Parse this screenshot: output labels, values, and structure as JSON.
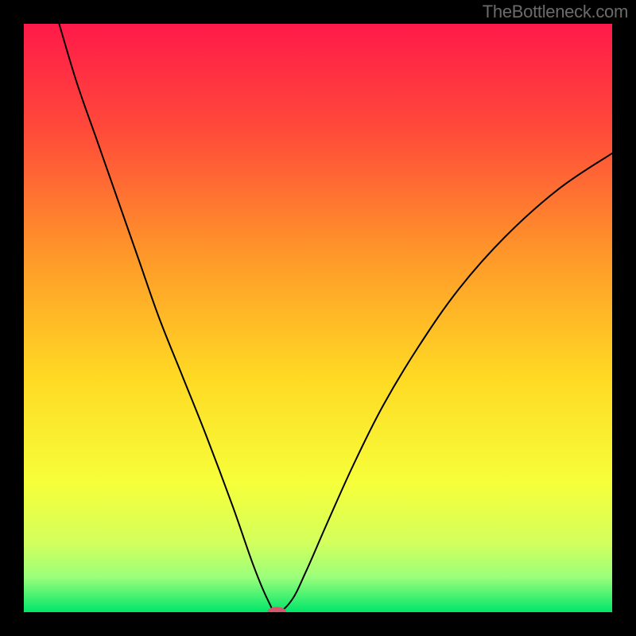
{
  "watermark": "TheBottleneck.com",
  "chart_data": {
    "type": "line",
    "title": "",
    "xlabel": "",
    "ylabel": "",
    "xlim": [
      0,
      100
    ],
    "ylim": [
      0,
      100
    ],
    "grid": false,
    "background_gradient": {
      "stops": [
        {
          "offset": 0.0,
          "color": "#ff1a49"
        },
        {
          "offset": 0.18,
          "color": "#ff4a3a"
        },
        {
          "offset": 0.4,
          "color": "#ff9a29"
        },
        {
          "offset": 0.6,
          "color": "#ffd924"
        },
        {
          "offset": 0.78,
          "color": "#f6ff3a"
        },
        {
          "offset": 0.88,
          "color": "#d4ff5c"
        },
        {
          "offset": 0.94,
          "color": "#9cff7a"
        },
        {
          "offset": 1.0,
          "color": "#00e66a"
        }
      ]
    },
    "curve": {
      "color": "#000000",
      "width": 2,
      "points": [
        {
          "x": 6.0,
          "y": 100.0
        },
        {
          "x": 9.0,
          "y": 90.0
        },
        {
          "x": 12.5,
          "y": 80.0
        },
        {
          "x": 16.0,
          "y": 70.0
        },
        {
          "x": 19.5,
          "y": 60.0
        },
        {
          "x": 23.0,
          "y": 50.0
        },
        {
          "x": 27.0,
          "y": 40.0
        },
        {
          "x": 31.0,
          "y": 30.0
        },
        {
          "x": 35.5,
          "y": 18.0
        },
        {
          "x": 39.0,
          "y": 8.0
        },
        {
          "x": 41.5,
          "y": 2.0
        },
        {
          "x": 43.0,
          "y": 0.0
        },
        {
          "x": 45.5,
          "y": 2.0
        },
        {
          "x": 48.0,
          "y": 7.0
        },
        {
          "x": 51.5,
          "y": 15.0
        },
        {
          "x": 56.0,
          "y": 25.0
        },
        {
          "x": 61.0,
          "y": 35.0
        },
        {
          "x": 67.0,
          "y": 45.0
        },
        {
          "x": 74.0,
          "y": 55.0
        },
        {
          "x": 82.0,
          "y": 64.0
        },
        {
          "x": 91.0,
          "y": 72.0
        },
        {
          "x": 100.0,
          "y": 78.0
        }
      ]
    },
    "marker": {
      "x": 43.0,
      "y": 0.0,
      "rx": 1.6,
      "ry": 0.9,
      "color": "#d5576e"
    }
  }
}
